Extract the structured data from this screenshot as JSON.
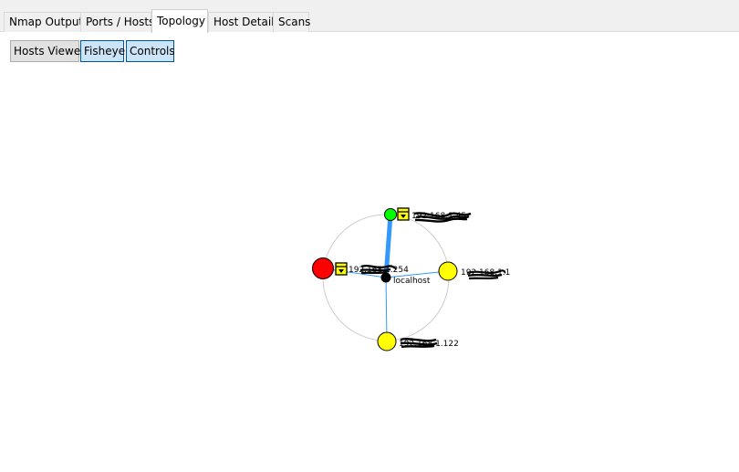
{
  "tabs": [
    {
      "label": "Nmap Output"
    },
    {
      "label": "Ports / Hosts"
    },
    {
      "label": "Topology"
    },
    {
      "label": "Host Details"
    },
    {
      "label": "Scans"
    }
  ],
  "toolbar": {
    "hosts_viewer": "Hosts Viewer",
    "fisheye": "Fisheye",
    "controls": "Controls"
  },
  "topology": {
    "center_label": "localhost",
    "hosts": [
      {
        "label": "192.168.1.45",
        "color": "#00ff00",
        "redacted": true
      },
      {
        "label": "192.168.1.1",
        "color": "#ffff00",
        "redacted": true
      },
      {
        "label": "192.168.1.122",
        "color": "#ffff00",
        "redacted": true
      },
      {
        "label": "192.168.1.254",
        "color": "#ff0000",
        "redacted": true
      }
    ],
    "colors": {
      "ring": "#cccccc",
      "edge": "#3399ff",
      "center": "#000000"
    }
  }
}
